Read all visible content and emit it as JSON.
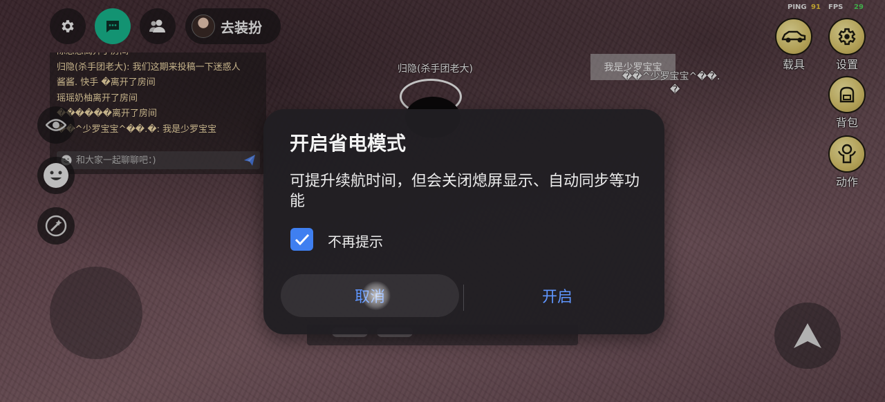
{
  "top_bar": {
    "dress_up_label": "去装扮"
  },
  "chat": {
    "lines": [
      "陈恙恙离开了房间",
      "归隐(杀手团老大): 我们这期来投稿一下迷惑人",
      "酱酱. 快手 �离开了房间",
      "瑶瑶奶柚离开了房间",
      "������离开了房间",
      "��^少罗宝宝^��.�: 我是少罗宝宝"
    ],
    "input_placeholder": "和大家一起聊聊吧：)"
  },
  "hud": {
    "ping_label": "PING",
    "ping_value": "91",
    "fps_label": "FPS",
    "fps_value": "29",
    "menu": [
      {
        "label": "载具",
        "icon": "car-icon"
      },
      {
        "label": "设置",
        "icon": "settings-gear-icon"
      },
      {
        "label": "背包",
        "icon": "backpack-icon"
      },
      {
        "label": "动作",
        "icon": "action-figure-icon"
      }
    ]
  },
  "world": {
    "player_name": "归隐(杀手团老大)",
    "other_player_name": "��^少罗宝宝^��.",
    "other_player_name_tail": "�",
    "speech_bubble": "我是少罗宝宝"
  },
  "dialog": {
    "title": "开启省电模式",
    "message": "可提升续航时间，但会关闭熄屏显示、自动同步等功能",
    "checkbox_label": "不再提示",
    "checkbox_checked": true,
    "cancel_label": "取消",
    "confirm_label": "开启",
    "accent_color": "#3f7ff0"
  }
}
